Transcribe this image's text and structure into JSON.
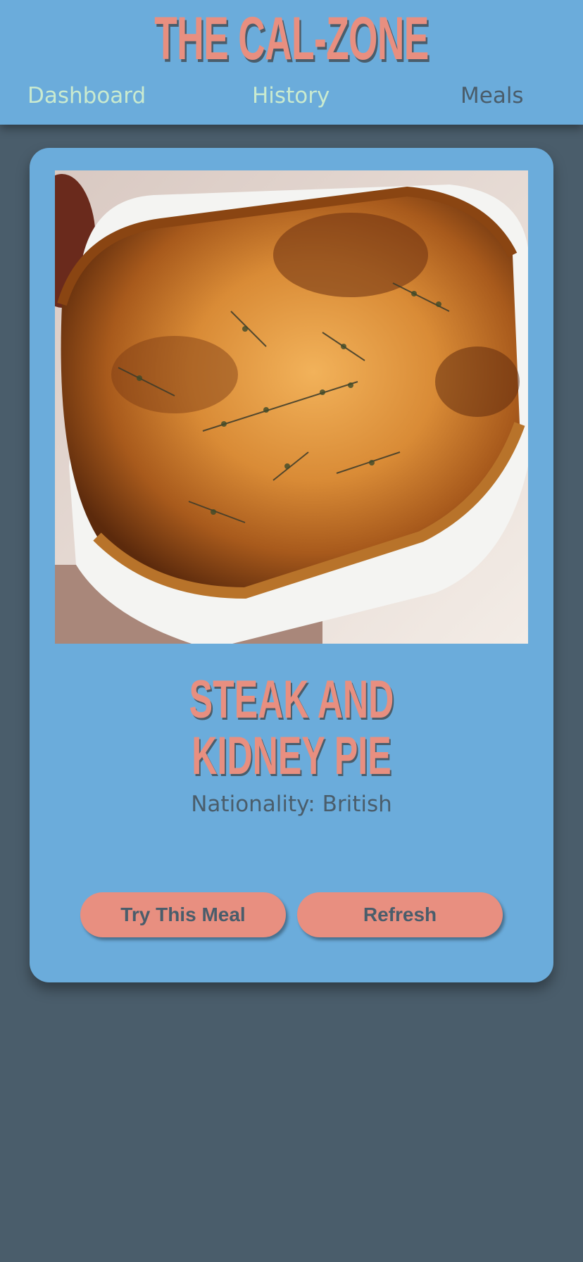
{
  "header": {
    "title": "THE CAL-ZONE",
    "nav": {
      "dashboard": "Dashboard",
      "history": "History",
      "meals": "Meals"
    }
  },
  "meal": {
    "name": "STEAK AND KIDNEY PIE",
    "nationality": "Nationality: British",
    "image_alt": "steak-and-kidney-pie-photo"
  },
  "actions": {
    "try_label": "Try This Meal",
    "refresh_label": "Refresh"
  },
  "colors": {
    "header_bg": "#6bacdb",
    "page_bg": "#4a5d6b",
    "accent": "#e88f80",
    "nav_inactive": "#c9eacf",
    "nav_active": "#4a5d6b"
  }
}
